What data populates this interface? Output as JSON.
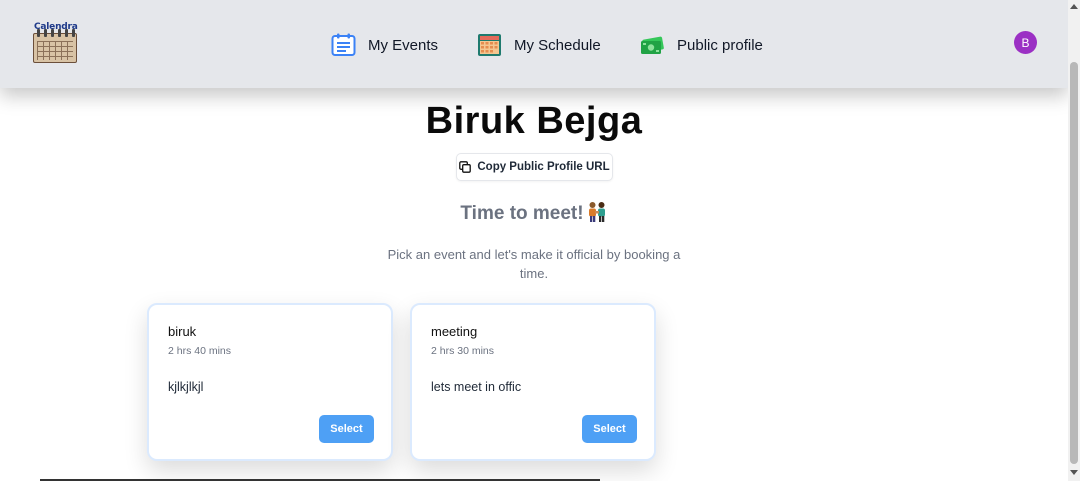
{
  "app": {
    "logo_text": "Calendra"
  },
  "nav": {
    "items": [
      {
        "label": "My Events",
        "icon": "calendar-list-icon"
      },
      {
        "label": "My Schedule",
        "icon": "schedule-grid-icon"
      },
      {
        "label": "Public profile",
        "icon": "money-profile-icon"
      }
    ],
    "avatar_initial": "B"
  },
  "profile": {
    "name": "Biruk Bejga",
    "copy_button_label": "Copy Public Profile URL",
    "meet_title": "Time to meet!",
    "meet_emoji": "people-holding-hands-icon",
    "description": "Pick an event and let's make it official by booking a time."
  },
  "events": [
    {
      "title": "biruk",
      "duration": "2 hrs 40 mins",
      "description": "kjlkjlkjl",
      "button_label": "Select"
    },
    {
      "title": "meeting",
      "duration": "2 hrs 30 mins",
      "description": "lets meet in offic",
      "button_label": "Select"
    }
  ],
  "colors": {
    "header_bg": "#e5e7eb",
    "avatar_bg": "#9b30c4",
    "select_button": "#4ea0f5",
    "card_border": "#dbeafe",
    "muted_text": "#6b7280"
  }
}
